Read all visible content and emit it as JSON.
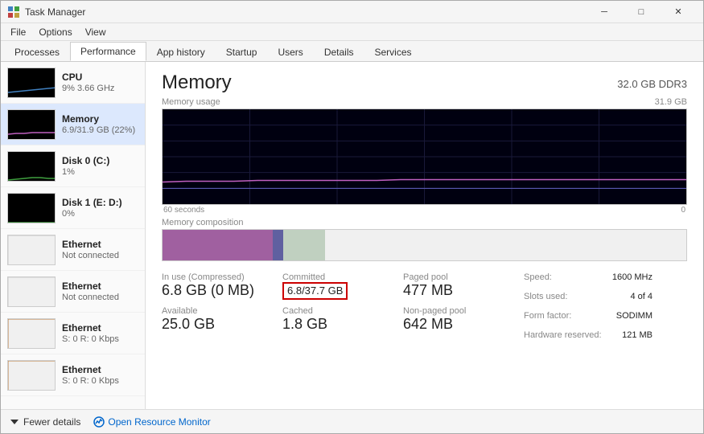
{
  "window": {
    "title": "Task Manager",
    "controls": {
      "minimize": "─",
      "maximize": "□",
      "close": "✕"
    }
  },
  "menu": {
    "items": [
      "File",
      "Options",
      "View"
    ]
  },
  "tabs": {
    "items": [
      "Processes",
      "Performance",
      "App history",
      "Startup",
      "Users",
      "Details",
      "Services"
    ],
    "active": "Performance"
  },
  "sidebar": {
    "items": [
      {
        "id": "cpu",
        "title": "CPU",
        "subtitle": "9% 3.66 GHz",
        "color": "#4080c0"
      },
      {
        "id": "memory",
        "title": "Memory",
        "subtitle": "6.9/31.9 GB (22%)",
        "color": "#a060a0",
        "active": true
      },
      {
        "id": "disk0",
        "title": "Disk 0 (C:)",
        "subtitle": "1%",
        "color": "#40a040"
      },
      {
        "id": "disk1",
        "title": "Disk 1 (E: D:)",
        "subtitle": "0%",
        "color": "#40a040"
      },
      {
        "id": "eth1",
        "title": "Ethernet",
        "subtitle": "Not connected",
        "color": "#c08040"
      },
      {
        "id": "eth2",
        "title": "Ethernet",
        "subtitle": "Not connected",
        "color": "#c08040"
      },
      {
        "id": "eth3",
        "title": "Ethernet",
        "subtitle": "S: 0 R: 0 Kbps",
        "color": "#c08040"
      },
      {
        "id": "eth4",
        "title": "Ethernet",
        "subtitle": "S: 0 R: 0 Kbps",
        "color": "#c08040"
      }
    ]
  },
  "detail": {
    "title": "Memory",
    "spec": "32.0 GB DDR3",
    "chart": {
      "label": "Memory usage",
      "max_label": "31.9 GB",
      "time_start": "60 seconds",
      "time_end": "0"
    },
    "composition": {
      "label": "Memory composition"
    },
    "stats": {
      "in_use_label": "In use (Compressed)",
      "in_use_value": "6.8 GB (0 MB)",
      "available_label": "Available",
      "available_value": "25.0 GB",
      "committed_label": "Committed",
      "committed_value": "6.8/37.7 GB",
      "cached_label": "Cached",
      "cached_value": "1.8 GB",
      "paged_pool_label": "Paged pool",
      "paged_pool_value": "477 MB",
      "non_paged_pool_label": "Non-paged pool",
      "non_paged_pool_value": "642 MB",
      "speed_label": "Speed:",
      "speed_value": "1600 MHz",
      "slots_label": "Slots used:",
      "slots_value": "4 of 4",
      "form_factor_label": "Form factor:",
      "form_factor_value": "SODIMM",
      "hardware_reserved_label": "Hardware reserved:",
      "hardware_reserved_value": "121 MB"
    }
  },
  "footer": {
    "fewer_details": "Fewer details",
    "open_resource_monitor": "Open Resource Monitor"
  }
}
